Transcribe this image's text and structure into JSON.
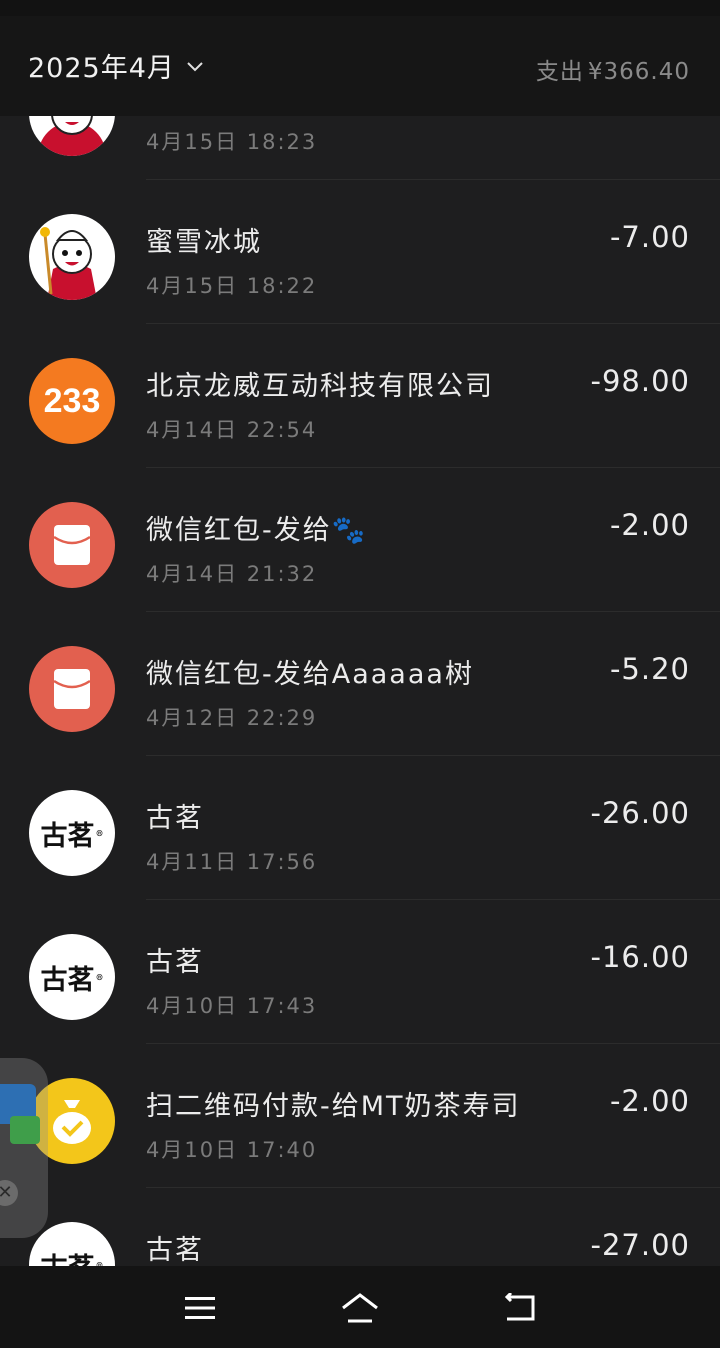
{
  "header": {
    "month_label": "2025年4月",
    "summary_label": "支出",
    "summary_amount": "¥366.40"
  },
  "transactions": [
    {
      "name": "",
      "time": "4月15日 18:23",
      "amount": "",
      "avatar": "snowman"
    },
    {
      "name": "蜜雪冰城",
      "time": "4月15日 18:22",
      "amount": "-7.00",
      "avatar": "snowman"
    },
    {
      "name": "北京龙威互动科技有限公司",
      "time": "4月14日 22:54",
      "amount": "-98.00",
      "avatar": "233",
      "avatar_text": "233"
    },
    {
      "name": "微信红包-发给🐾",
      "time": "4月14日 21:32",
      "amount": "-2.00",
      "avatar": "red-packet"
    },
    {
      "name": "微信红包-发给Aaaaaa树",
      "time": "4月12日 22:29",
      "amount": "-5.20",
      "avatar": "red-packet"
    },
    {
      "name": "古茗",
      "time": "4月11日 17:56",
      "amount": "-26.00",
      "avatar": "guming",
      "avatar_text": "古茗"
    },
    {
      "name": "古茗",
      "time": "4月10日 17:43",
      "amount": "-16.00",
      "avatar": "guming",
      "avatar_text": "古茗"
    },
    {
      "name": "扫二维码付款-给MT奶茶寿司",
      "time": "4月10日 17:40",
      "amount": "-2.00",
      "avatar": "money-bag"
    },
    {
      "name": "古茗",
      "time": "",
      "amount": "-27.00",
      "avatar": "guming",
      "avatar_text": "古茗"
    }
  ],
  "colors": {
    "background": "#1e1e1f",
    "header_bg": "#161616",
    "red_packet": "#e2604f",
    "badge_orange": "#f47a20",
    "pay_yellow": "#f3c61a"
  },
  "icons": [
    "chevron-down-icon",
    "menu-icon",
    "home-icon",
    "back-icon",
    "close-icon"
  ]
}
